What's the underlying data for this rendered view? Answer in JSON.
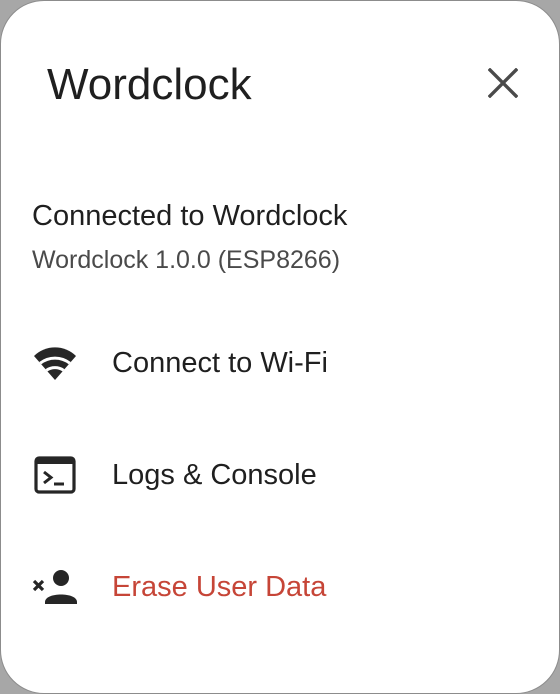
{
  "dialog": {
    "title": "Wordclock",
    "close_icon": "close-icon"
  },
  "status": {
    "title": "Connected to Wordclock",
    "subtitle": "Wordclock 1.0.0 (ESP8266)"
  },
  "menu": [
    {
      "label": "Connect to Wi-Fi",
      "icon": "wifi-icon"
    },
    {
      "label": "Logs & Console",
      "icon": "terminal-icon"
    },
    {
      "label": "Erase User Data",
      "icon": "person-remove-icon",
      "color": "#c64537"
    }
  ],
  "colors": {
    "text": "#1f1f1f",
    "secondary_text": "#4a4a4a",
    "danger": "#c64537",
    "background": "#ffffff"
  }
}
